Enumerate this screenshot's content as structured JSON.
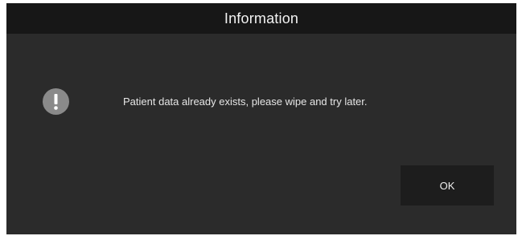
{
  "dialog": {
    "title": "Information",
    "message": "Patient data already exists, please wipe and try later.",
    "icon": "exclamation-icon",
    "ok_label": "OK"
  },
  "colors": {
    "background": "#2b2b2b",
    "titlebar": "#171717",
    "icon_circle": "#8a8a8a",
    "button": "#1d1d1d",
    "text": "#e6e6e6"
  }
}
